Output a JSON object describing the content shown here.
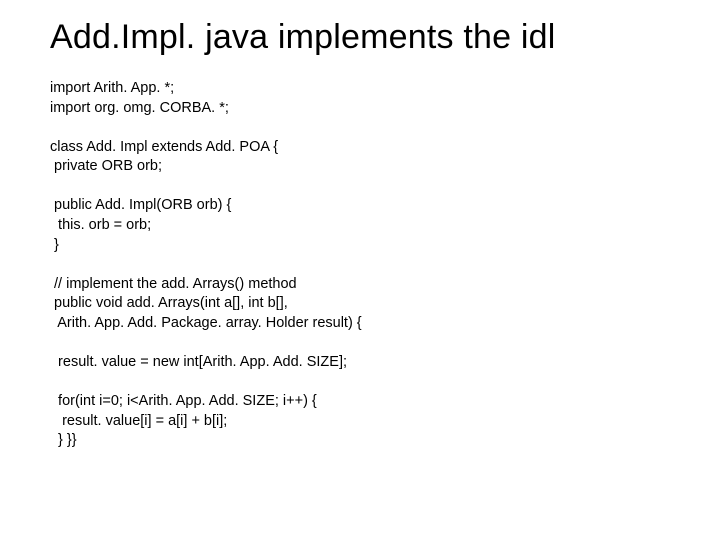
{
  "title": "Add.Impl. java implements the idl",
  "code": {
    "l1": "import Arith. App. *;",
    "l2": "import org. omg. CORBA. *;",
    "l3": "",
    "l4": "class Add. Impl extends Add. POA {",
    "l5": " private ORB orb;",
    "l6": "",
    "l7": " public Add. Impl(ORB orb) {",
    "l8": "  this. orb = orb;",
    "l9": " }",
    "l10": "",
    "l11": " // implement the add. Arrays() method",
    "l12": " public void add. Arrays(int a[], int b[],",
    "l13": "  Arith. App. Add. Package. array. Holder result) {",
    "l14": "",
    "l15": "  result. value = new int[Arith. App. Add. SIZE];",
    "l16": "",
    "l17": "  for(int i=0; i<Arith. App. Add. SIZE; i++) {",
    "l18": "   result. value[i] = a[i] + b[i];",
    "l19": "  } }}"
  }
}
